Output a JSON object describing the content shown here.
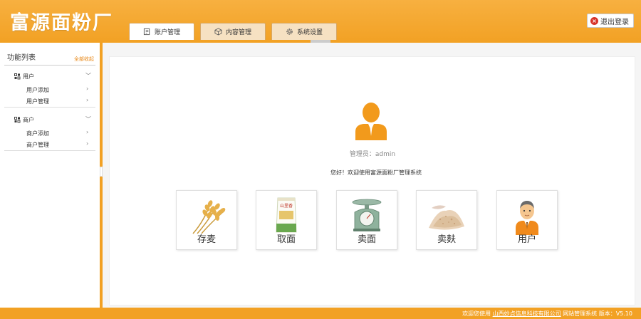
{
  "header": {
    "logo": "富源面粉厂",
    "tabs": [
      {
        "label": "账户管理",
        "icon": "edit-icon"
      },
      {
        "label": "内容管理",
        "icon": "box-icon"
      },
      {
        "label": "系统设置",
        "icon": "gear-icon"
      }
    ],
    "logout_label": "退出登录"
  },
  "sidebar": {
    "title": "功能列表",
    "collapse_all": "全部收起",
    "groups": [
      {
        "label": "用户",
        "items": [
          {
            "label": "用户添加"
          },
          {
            "label": "用户管理"
          }
        ]
      },
      {
        "label": "商户",
        "items": [
          {
            "label": "商户添加"
          },
          {
            "label": "商户管理"
          }
        ]
      }
    ]
  },
  "main": {
    "role_label": "管理员：admin",
    "welcome": "您好！欢迎使用富源面粉厂管理系统",
    "cards": [
      {
        "label": "存麦",
        "icon": "wheat-icon"
      },
      {
        "label": "取面",
        "icon": "flour-bag-icon"
      },
      {
        "label": "卖面",
        "icon": "scale-icon"
      },
      {
        "label": "卖麸",
        "icon": "bran-pile-icon"
      },
      {
        "label": "用户",
        "icon": "user-avatar-icon"
      }
    ]
  },
  "footer": {
    "prefix": "欢迎您使用",
    "company": "山西妙点信息科技有限公司",
    "suffix": "网站管理系统",
    "version": "版本：V5.10"
  },
  "colors": {
    "accent": "#f2a124",
    "link": "#e8891a",
    "logout_icon": "#d7342a"
  }
}
